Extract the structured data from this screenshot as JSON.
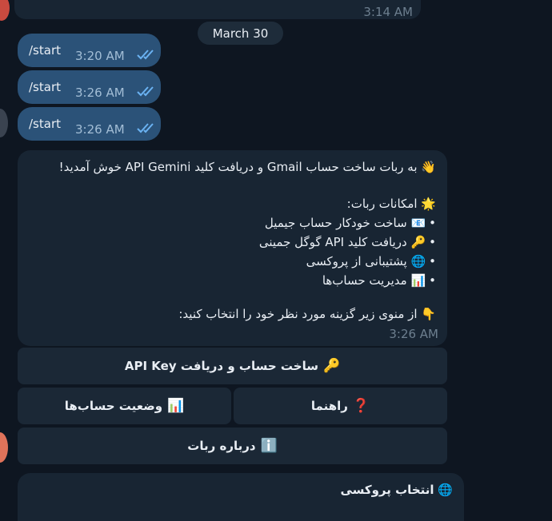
{
  "prev_message": {
    "time": "3:14 AM"
  },
  "date_separator": "March 30",
  "outgoing": [
    {
      "text": "/start",
      "time": "3:20 AM"
    },
    {
      "text": "/start",
      "time": "3:26 AM"
    },
    {
      "text": "/start",
      "time": "3:26 AM"
    }
  ],
  "bot_message": {
    "welcome": "به ربات ساخت حساب Gmail و دریافت کلید API Gemini خوش آمدید!",
    "features_title": "امکانات ربات:",
    "features": [
      "ساخت خودکار حساب جیمیل",
      "دریافت کلید API گوگل جمینی",
      "پشتیبانی از پروکسی",
      "مدیریت حساب‌ها"
    ],
    "prompt": "از منوی زیر گزینه مورد نظر خود را انتخاب کنید:",
    "time": "3:26 AM"
  },
  "keyboard": {
    "create_account": "ساخت حساب و دریافت API Key",
    "account_status": "وضعیت حساب‌ها",
    "help": "راهنما",
    "about": "درباره ربات"
  },
  "next_message": {
    "text": "انتخاب پروکسی"
  },
  "icons": {
    "welcome": "waving-hand",
    "features": "glowing-star",
    "feature_items": [
      "envelope",
      "key",
      "globe",
      "bar-chart"
    ],
    "prompt": "pointing-down",
    "create_account": "key",
    "account_status": "bar-chart",
    "help": "red-question-mark",
    "about": "information",
    "proxy": "globe"
  },
  "colors": {
    "background": "#0e1621",
    "outgoing_bubble": "#2b5278",
    "incoming_bubble": "#182533",
    "button": "#1b2836",
    "read_check": "#6ab2f2"
  }
}
